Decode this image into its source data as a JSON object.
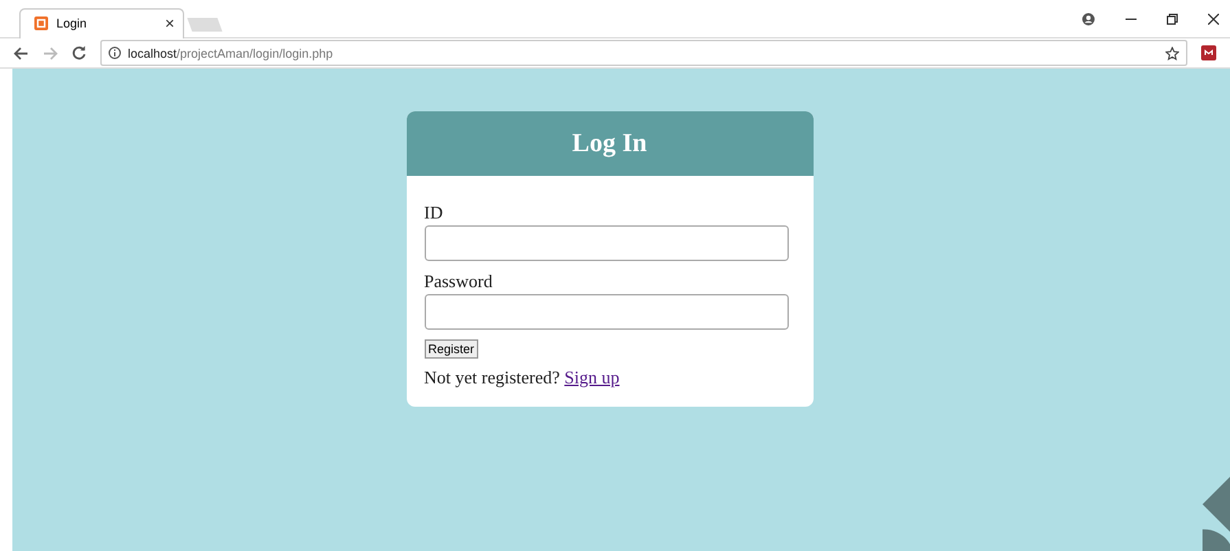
{
  "browser": {
    "tab": {
      "title": "Login",
      "close": "×"
    },
    "address": {
      "host": "localhost",
      "path": "/projectAman/login/login.php"
    }
  },
  "login": {
    "title": "Log In",
    "fields": [
      {
        "label": "ID"
      },
      {
        "label": "Password"
      }
    ],
    "button": "Register",
    "prompt": "Not yet registered?",
    "link": "Sign up"
  }
}
